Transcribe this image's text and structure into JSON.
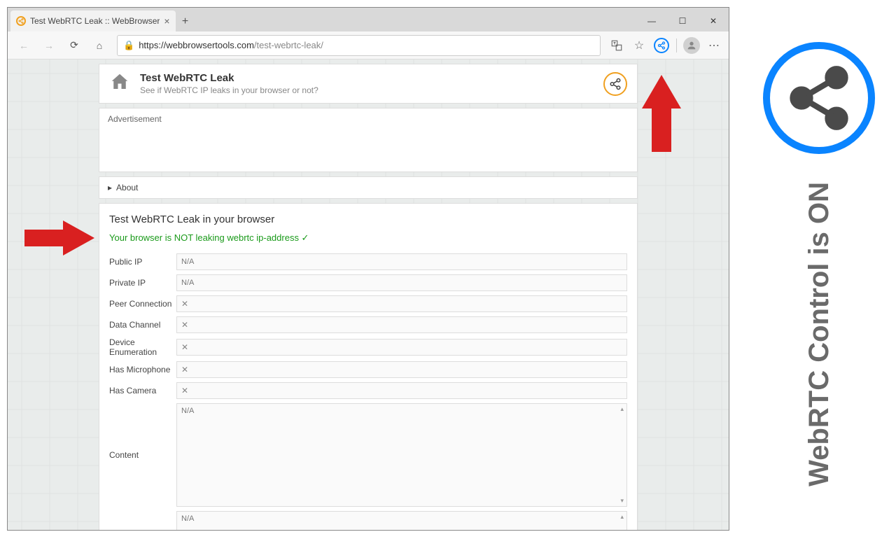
{
  "tab": {
    "title": "Test WebRTC Leak :: WebBrowser"
  },
  "url": {
    "host": "https://webbrowsertools.com",
    "path": "/test-webrtc-leak/"
  },
  "header": {
    "title": "Test WebRTC Leak",
    "subtitle": "See if WebRTC IP leaks in your browser or not?"
  },
  "advertisement_label": "Advertisement",
  "about_label": "About",
  "main": {
    "title": "Test WebRTC Leak in your browser",
    "ok_message": "Your browser is NOT leaking webrtc ip-address ✓"
  },
  "rows": [
    {
      "label": "Public IP",
      "value": "N/A",
      "is_x": false
    },
    {
      "label": "Private IP",
      "value": "N/A",
      "is_x": false
    },
    {
      "label": "Peer Connection",
      "value": "✕",
      "is_x": true
    },
    {
      "label": "Data Channel",
      "value": "✕",
      "is_x": true
    },
    {
      "label": "Device Enumeration",
      "value": "✕",
      "is_x": true
    },
    {
      "label": "Has Microphone",
      "value": "✕",
      "is_x": true
    },
    {
      "label": "Has Camera",
      "value": "✕",
      "is_x": true
    }
  ],
  "content_row": {
    "label": "Content",
    "value": "N/A"
  },
  "extra_row": {
    "value": "N/A"
  },
  "side": {
    "text": "WebRTC Control is ON"
  },
  "colors": {
    "accent": "#0a84ff",
    "ok": "#1a9a1a",
    "badge": "#f0a020",
    "red": "#d92020"
  }
}
